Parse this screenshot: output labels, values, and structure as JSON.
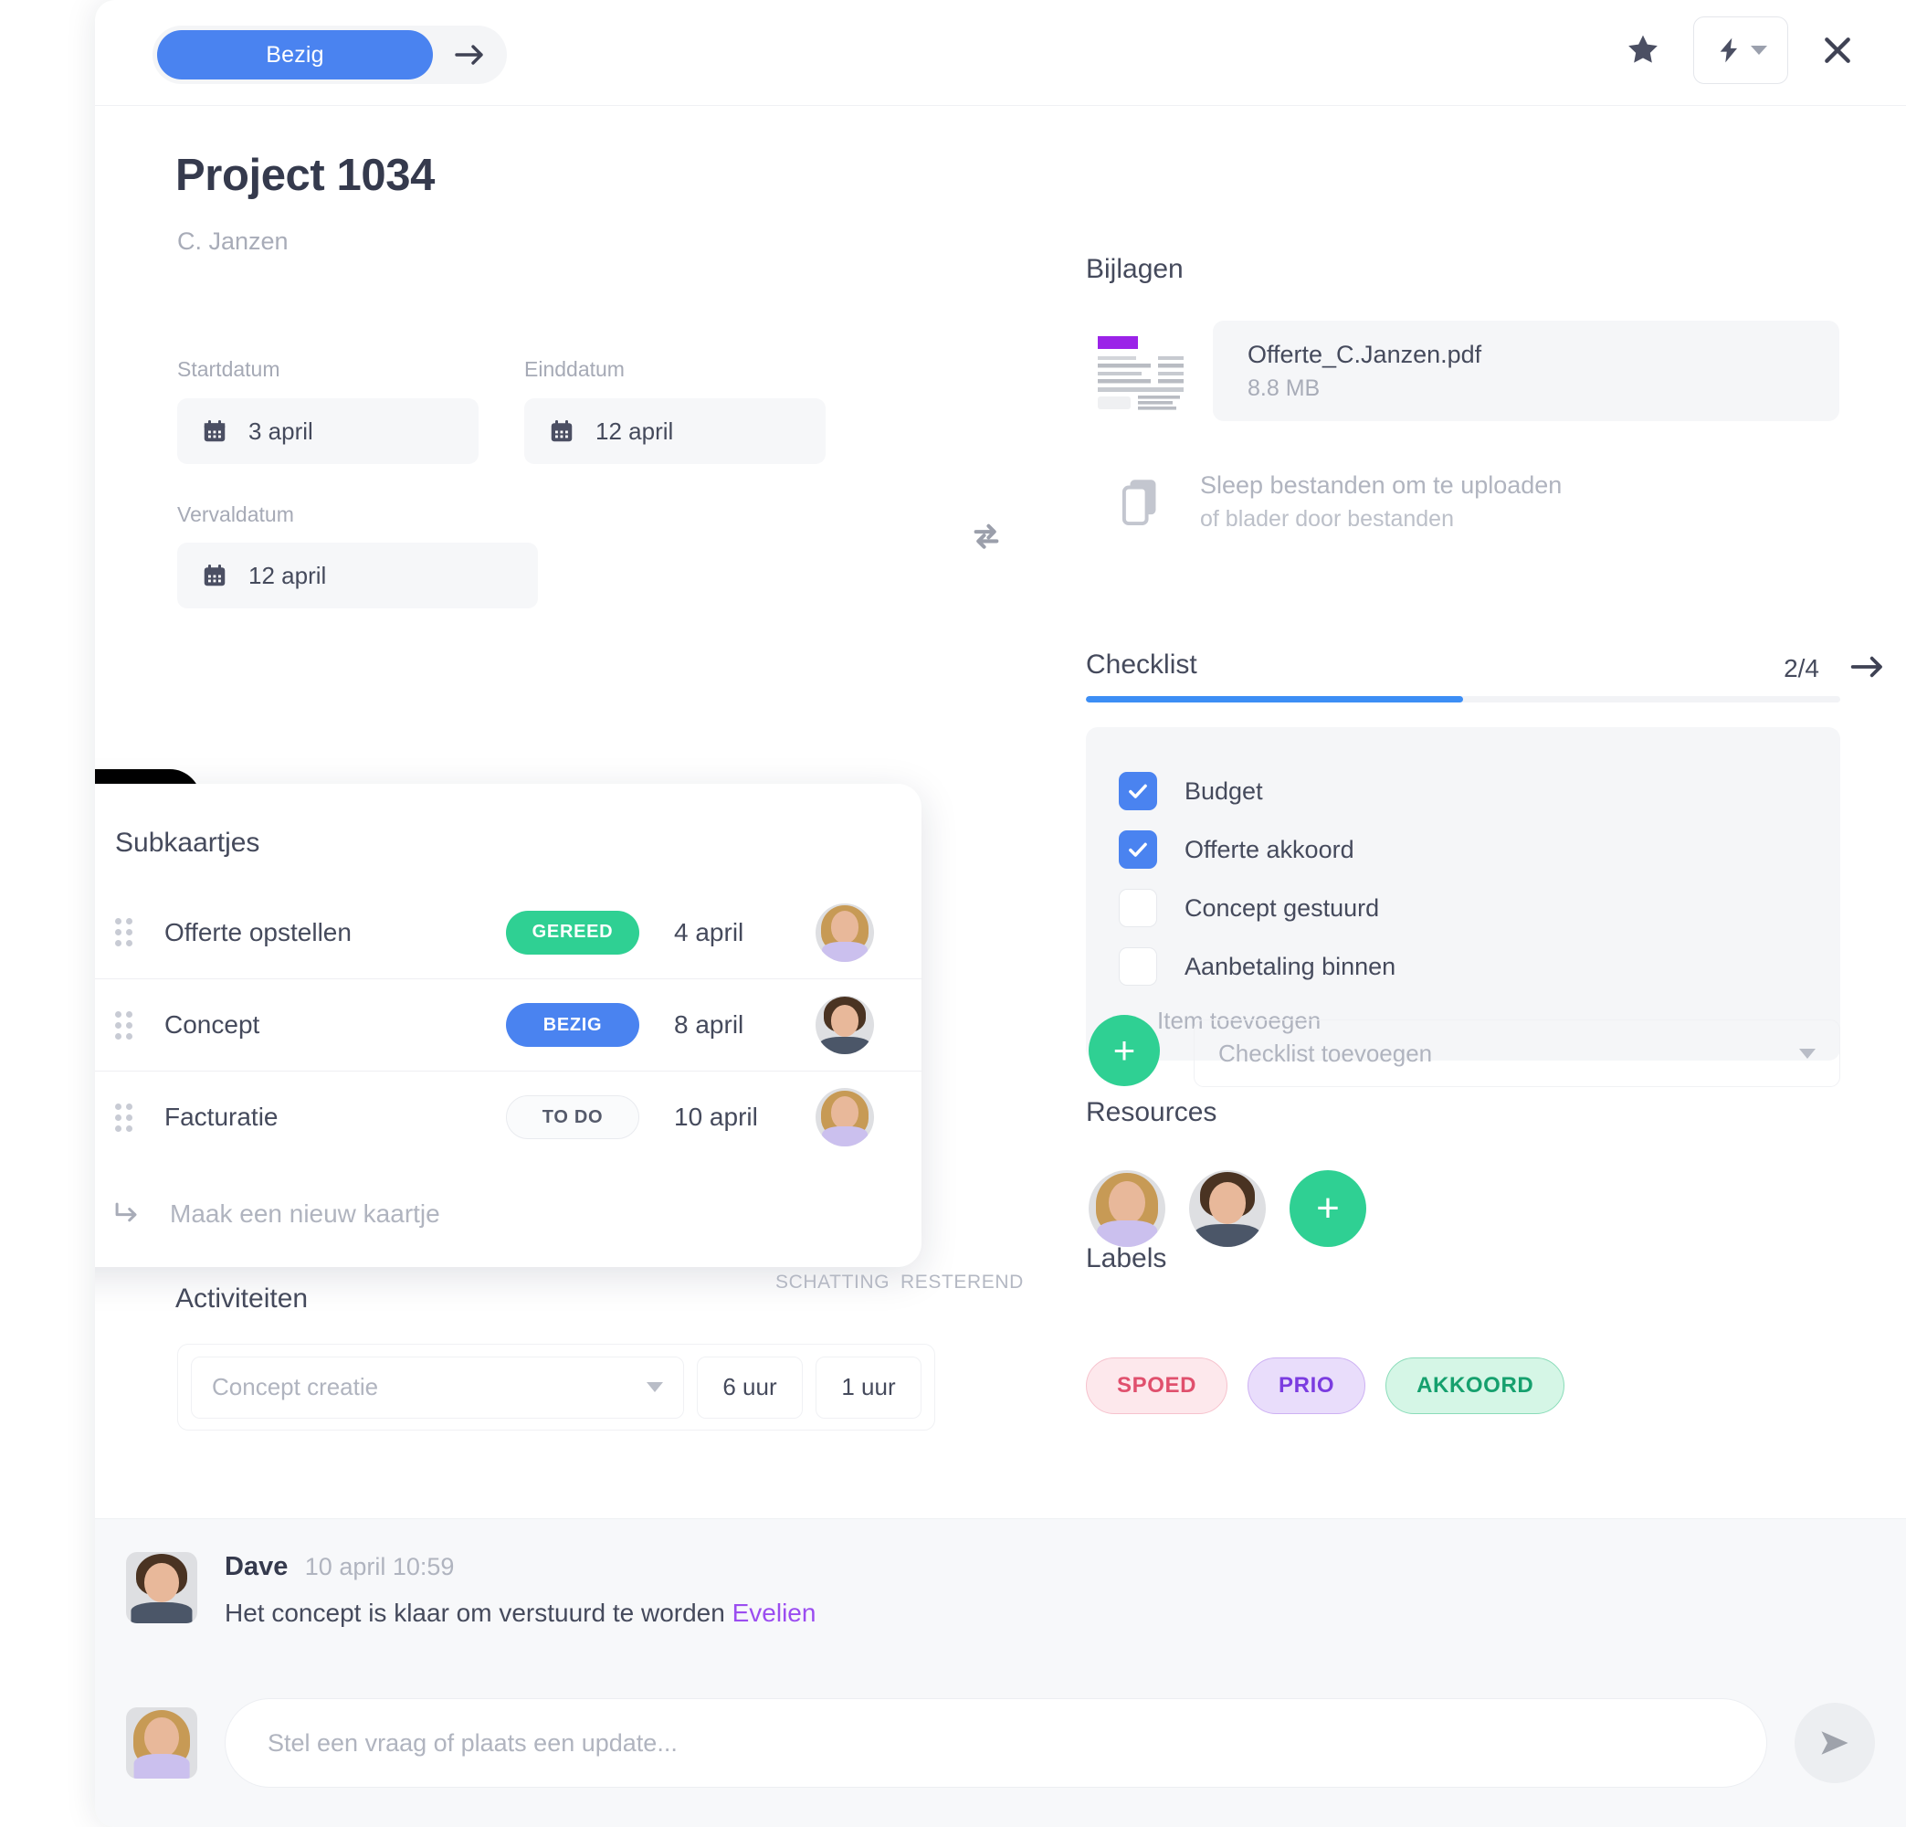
{
  "header": {
    "status_label": "Bezig",
    "next_icon": "arrow-right-icon",
    "star_icon": "star-icon",
    "bolt_icon": "lightning-bolt-icon",
    "close_icon": "close-icon"
  },
  "project": {
    "title": "Project 1034",
    "client": "C. Janzen",
    "dates": [
      {
        "label": "Startdatum",
        "value": "3 april"
      },
      {
        "label": "Einddatum",
        "value": "12 april"
      },
      {
        "label": "Vervaldatum",
        "value": "12 april"
      }
    ],
    "swap_icon": "swap-arrows-icon"
  },
  "subcards": {
    "title": "Subkaartjes",
    "rows": [
      {
        "name": "Offerte opstellen",
        "status": "GEREED",
        "status_kind": "gereed",
        "date": "4 april",
        "avatar": "fem"
      },
      {
        "name": "Concept",
        "status": "BEZIG",
        "status_kind": "bezig",
        "date": "8 april",
        "avatar": "mal"
      },
      {
        "name": "Facturatie",
        "status": "TO DO",
        "status_kind": "todo",
        "date": "10 april",
        "avatar": "fem"
      }
    ],
    "new_card_label": "Maak een nieuw kaartje"
  },
  "activities": {
    "title": "Activiteiten",
    "col_estimate": "SCHATTING",
    "col_remaining": "RESTEREND",
    "row": {
      "name_placeholder": "Concept creatie",
      "estimate": "6 uur",
      "remaining": "1 uur"
    }
  },
  "attachments": {
    "title": "Bijlagen",
    "file": {
      "name": "Offerte_C.Janzen.pdf",
      "size": "8.8 MB"
    },
    "drop_title": "Sleep bestanden om te uploaden",
    "drop_sub": "of blader door bestanden"
  },
  "checklist": {
    "title": "Checklist",
    "count": "2/4",
    "progress_pct": 50,
    "items": [
      {
        "label": "Budget",
        "checked": true
      },
      {
        "label": "Offerte akkoord",
        "checked": true
      },
      {
        "label": "Concept gestuurd",
        "checked": false
      },
      {
        "label": "Aanbetaling binnen",
        "checked": false
      }
    ],
    "add_item_label": "Item toevoegen",
    "add_button_label": "+",
    "add_select_placeholder": "Checklist toevoegen"
  },
  "resources": {
    "title": "Resources",
    "members": [
      "fem",
      "mal"
    ],
    "add_button_label": "+"
  },
  "labels": {
    "title": "Labels",
    "items": [
      {
        "text": "SPOED",
        "bg": "#fde8ec",
        "fg": "#e0506d",
        "border": "#f6c2cd"
      },
      {
        "text": "PRIO",
        "bg": "#e9ddfb",
        "fg": "#7b3ce0",
        "border": "#cdb1f3"
      },
      {
        "text": "AKKOORD",
        "bg": "#d5f6e6",
        "fg": "#16a06e",
        "border": "#8adcb9"
      }
    ]
  },
  "comments": {
    "entry": {
      "author": "Dave",
      "time": "10 april 10:59",
      "text": "Het concept is klaar om verstuurd te worden ",
      "mention": "Evelien"
    },
    "composer_placeholder": "Stel een vraag of plaats een update...",
    "send_icon": "send-icon"
  },
  "colors": {
    "accent_blue": "#4a83f0",
    "accent_green": "#2fd093",
    "progress_blue": "#3c8ef5"
  }
}
